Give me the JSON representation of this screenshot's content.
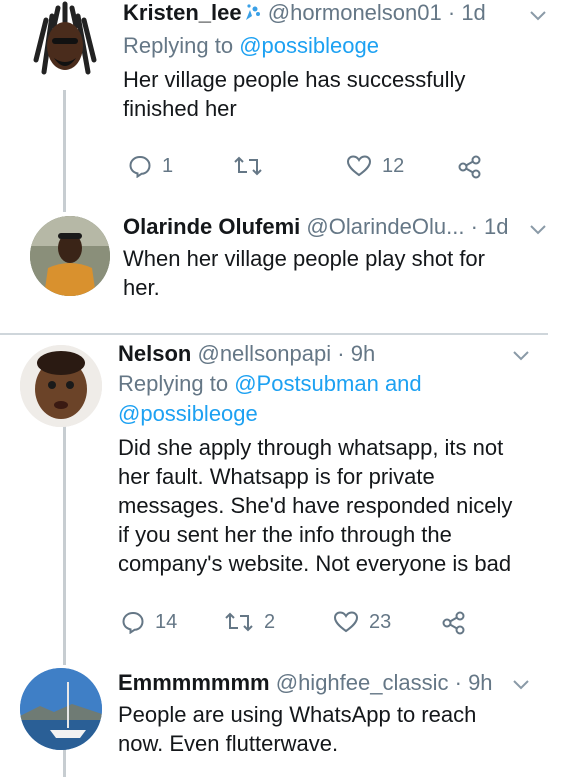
{
  "tweets": [
    {
      "name": "Kristen_lee",
      "handle": "@hormonelson01",
      "time": "· 1d",
      "replying_prefix": "Replying to",
      "replying_to": "@possibleoge",
      "text_lines": [
        "Her village people has successfully",
        "finished her"
      ],
      "replies": "1",
      "retweets": "",
      "likes": "12"
    },
    {
      "name": "Olarinde Olufemi",
      "handle": "@OlarindeOlu...",
      "time": "· 1d",
      "text_lines": [
        "When her village people play shot for",
        "her."
      ]
    },
    {
      "name": "Nelson",
      "handle": "@nellsonpapi",
      "time": "· 9h",
      "replying_prefix": "Replying to",
      "replying_to_line1": "@Postsubman and",
      "replying_to_line2": "@possibleoge",
      "text_lines": [
        "Did she apply through whatsapp, its not",
        "her fault. Whatsapp is for private",
        "messages. She'd have responded nicely",
        "if you sent her the info through the",
        "company's website. Not everyone is bad"
      ],
      "replies": "14",
      "retweets": "2",
      "likes": "23"
    },
    {
      "name": "Emmmmmmm",
      "handle": "@highfee_classic",
      "time": "· 9h",
      "text_lines": [
        "People are using WhatsApp to reach",
        "now. Even flutterwave."
      ]
    }
  ],
  "icons": {
    "reply": "reply-icon",
    "retweet": "retweet-icon",
    "like": "heart-icon",
    "share": "share-icon",
    "more": "chevron-down-icon",
    "verified_emoji": "splash-emoji-icon"
  },
  "colors": {
    "link": "#1da1f2",
    "muted": "#657786",
    "line": "#c7cdd1"
  }
}
